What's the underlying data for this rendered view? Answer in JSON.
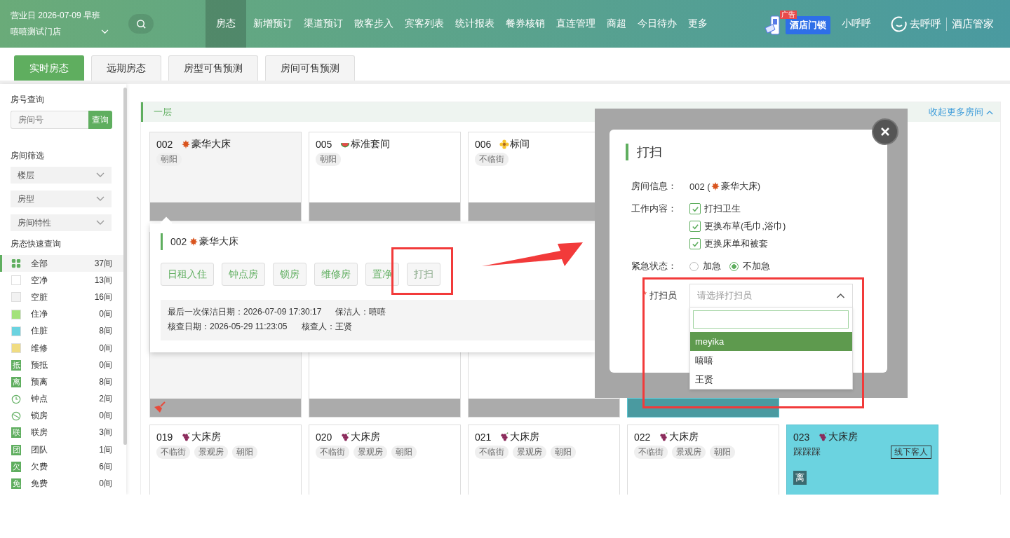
{
  "header": {
    "business_day": "营业日 2026-07-09 早班",
    "store": "嘻嘻测试门店",
    "nav": [
      {
        "label": "房态",
        "selected": true
      },
      {
        "label": "新增预订",
        "selected": false
      },
      {
        "label": "渠道预订",
        "selected": false
      },
      {
        "label": "散客步入",
        "selected": false
      },
      {
        "label": "宾客列表",
        "selected": false
      },
      {
        "label": "统计报表",
        "selected": false
      },
      {
        "label": "餐券核销",
        "selected": false
      },
      {
        "label": "直连管理",
        "selected": false
      },
      {
        "label": "商超",
        "selected": false
      },
      {
        "label": "今日待办",
        "selected": false
      },
      {
        "label": "更多",
        "selected": false
      }
    ],
    "ad_badge": "广告",
    "ad_label": "酒店门锁",
    "user": "小呼呼",
    "brand": "去呼呼",
    "brand_sub": "酒店管家"
  },
  "tabs": [
    {
      "label": "实时房态",
      "selected": true
    },
    {
      "label": "远期房态",
      "selected": false
    },
    {
      "label": "房型可售预测",
      "selected": false
    },
    {
      "label": "房间可售预测",
      "selected": false
    }
  ],
  "sidebar": {
    "search_title": "房号查询",
    "search_placeholder": "房间号",
    "search_button": "查询",
    "filter_title": "房间筛选",
    "filters": [
      "楼层",
      "房型",
      "房间特性"
    ],
    "quick_title": "房态快速查询",
    "statuses": [
      {
        "kind": "grid",
        "label": "全部",
        "count": "37间",
        "selected": true
      },
      {
        "kind": "swatch",
        "color": "#ffffff",
        "label": "空净",
        "count": "13间",
        "selected": false
      },
      {
        "kind": "swatch",
        "color": "#f2f2f2",
        "label": "空脏",
        "count": "16间",
        "selected": false
      },
      {
        "kind": "swatch",
        "color": "#a3e27a",
        "label": "住净",
        "count": "0间",
        "selected": false
      },
      {
        "kind": "swatch",
        "color": "#6bd3e0",
        "label": "住脏",
        "count": "8间",
        "selected": false
      },
      {
        "kind": "swatch",
        "color": "#f0dc82",
        "label": "维修",
        "count": "0间",
        "selected": false
      },
      {
        "kind": "tag",
        "tag": "抵",
        "label": "预抵",
        "count": "0间",
        "selected": false
      },
      {
        "kind": "tag",
        "tag": "离",
        "label": "预离",
        "count": "8间",
        "selected": false
      },
      {
        "kind": "clock",
        "label": "钟点",
        "count": "2间",
        "selected": false
      },
      {
        "kind": "lock",
        "label": "锁房",
        "count": "0间",
        "selected": false
      },
      {
        "kind": "tag",
        "tag": "联",
        "label": "联房",
        "count": "3间",
        "selected": false
      },
      {
        "kind": "tag",
        "tag": "团",
        "label": "团队",
        "count": "1间",
        "selected": false
      },
      {
        "kind": "tag",
        "tag": "欠",
        "label": "欠费",
        "count": "6间",
        "selected": false
      },
      {
        "kind": "tag",
        "tag": "免",
        "label": "免费",
        "count": "0间",
        "selected": false
      }
    ]
  },
  "floor": {
    "title": "一层",
    "collapse": "收起更多房间"
  },
  "room_rows": [
    {
      "rooms": [
        {
          "kind": "vacant_dirty",
          "number": "002",
          "type_mark": {
            "kind": "maple"
          },
          "type": "豪华大床",
          "tags": [
            "朝阳"
          ]
        },
        {
          "kind": "vacant_clean",
          "number": "005",
          "type_mark": {
            "kind": "melon"
          },
          "type": "标准套间",
          "tags": [
            "朝阳"
          ]
        },
        {
          "kind": "vacant_clean",
          "number": "006",
          "type_mark": {
            "kind": "flower"
          },
          "type": "标间",
          "tags": [
            "不临街"
          ]
        }
      ]
    },
    {
      "rooms": [
        {
          "kind": "vacant_dirty",
          "needs_cleaning": true
        },
        {
          "kind": "vacant_clean",
          "needs_cleaning": false
        },
        {
          "kind": "vacant_clean",
          "needs_cleaning": false
        },
        {
          "kind": "occupied_dirty",
          "needs_cleaning": false
        }
      ]
    },
    {
      "rooms": [
        {
          "kind": "vacant_clean",
          "number": "019",
          "type_mark": {
            "kind": "grape"
          },
          "type": "大床房",
          "tags": [
            "不临街",
            "景观房",
            "朝阳"
          ]
        },
        {
          "kind": "vacant_clean",
          "number": "020",
          "type_mark": {
            "kind": "grape"
          },
          "type": "大床房",
          "tags": [
            "不临街",
            "景观房",
            "朝阳"
          ]
        },
        {
          "kind": "vacant_clean",
          "number": "021",
          "type_mark": {
            "kind": "grape"
          },
          "type": "大床房",
          "tags": [
            "不临街",
            "景观房",
            "朝阳"
          ]
        },
        {
          "kind": "vacant_clean",
          "number": "022",
          "type_mark": {
            "kind": "grape"
          },
          "type": "大床房",
          "tags": [
            "不临街",
            "景观房",
            "朝阳"
          ]
        },
        {
          "kind": "occupied_dirty",
          "number": "023",
          "type_mark": {
            "kind": "grape"
          },
          "type": "大床房",
          "guest": "踩踩踩",
          "source": "线下客人",
          "flag": "离"
        }
      ]
    }
  ],
  "popup": {
    "number": "002",
    "type_mark": {
      "kind": "maple"
    },
    "type": "豪华大床",
    "actions": [
      {
        "label": "日租入住",
        "muted": false
      },
      {
        "label": "钟点房",
        "muted": false
      },
      {
        "label": "锁房",
        "muted": false
      },
      {
        "label": "维修房",
        "muted": false
      },
      {
        "label": "置净",
        "muted": false
      },
      {
        "label": "打扫",
        "muted": true
      }
    ],
    "info": [
      [
        "最后一次保洁日期：2026-07-09 17:30:17",
        "保洁人：嘻嘻"
      ],
      [
        "核查日期：2026-05-29 11:23:05",
        "核查人：王贤"
      ]
    ]
  },
  "modal": {
    "title": "打扫",
    "room_label": "房间信息：",
    "room_number": "002 (",
    "room_mark": {
      "kind": "maple"
    },
    "room_type": "豪华大床)",
    "work_label": "工作内容：",
    "work_items": [
      {
        "label": "打扫卫生",
        "checked": true
      },
      {
        "label": "更换布草(毛巾,浴巾)",
        "checked": true
      },
      {
        "label": "更换床单和被套",
        "checked": true
      }
    ],
    "urgency_label": "紧急状态：",
    "urgency_options": [
      {
        "label": "加急",
        "selected": false
      },
      {
        "label": "不加急",
        "selected": true
      }
    ],
    "cleaner_required_mark": "*",
    "cleaner_label": "打扫员",
    "cleaner_placeholder": "请选择打扫员",
    "cleaner_expanded": true,
    "cleaner_options": [
      {
        "label": "meyika",
        "selected": true
      },
      {
        "label": "嘻嘻",
        "selected": false
      },
      {
        "label": "王贤",
        "selected": false
      }
    ]
  }
}
